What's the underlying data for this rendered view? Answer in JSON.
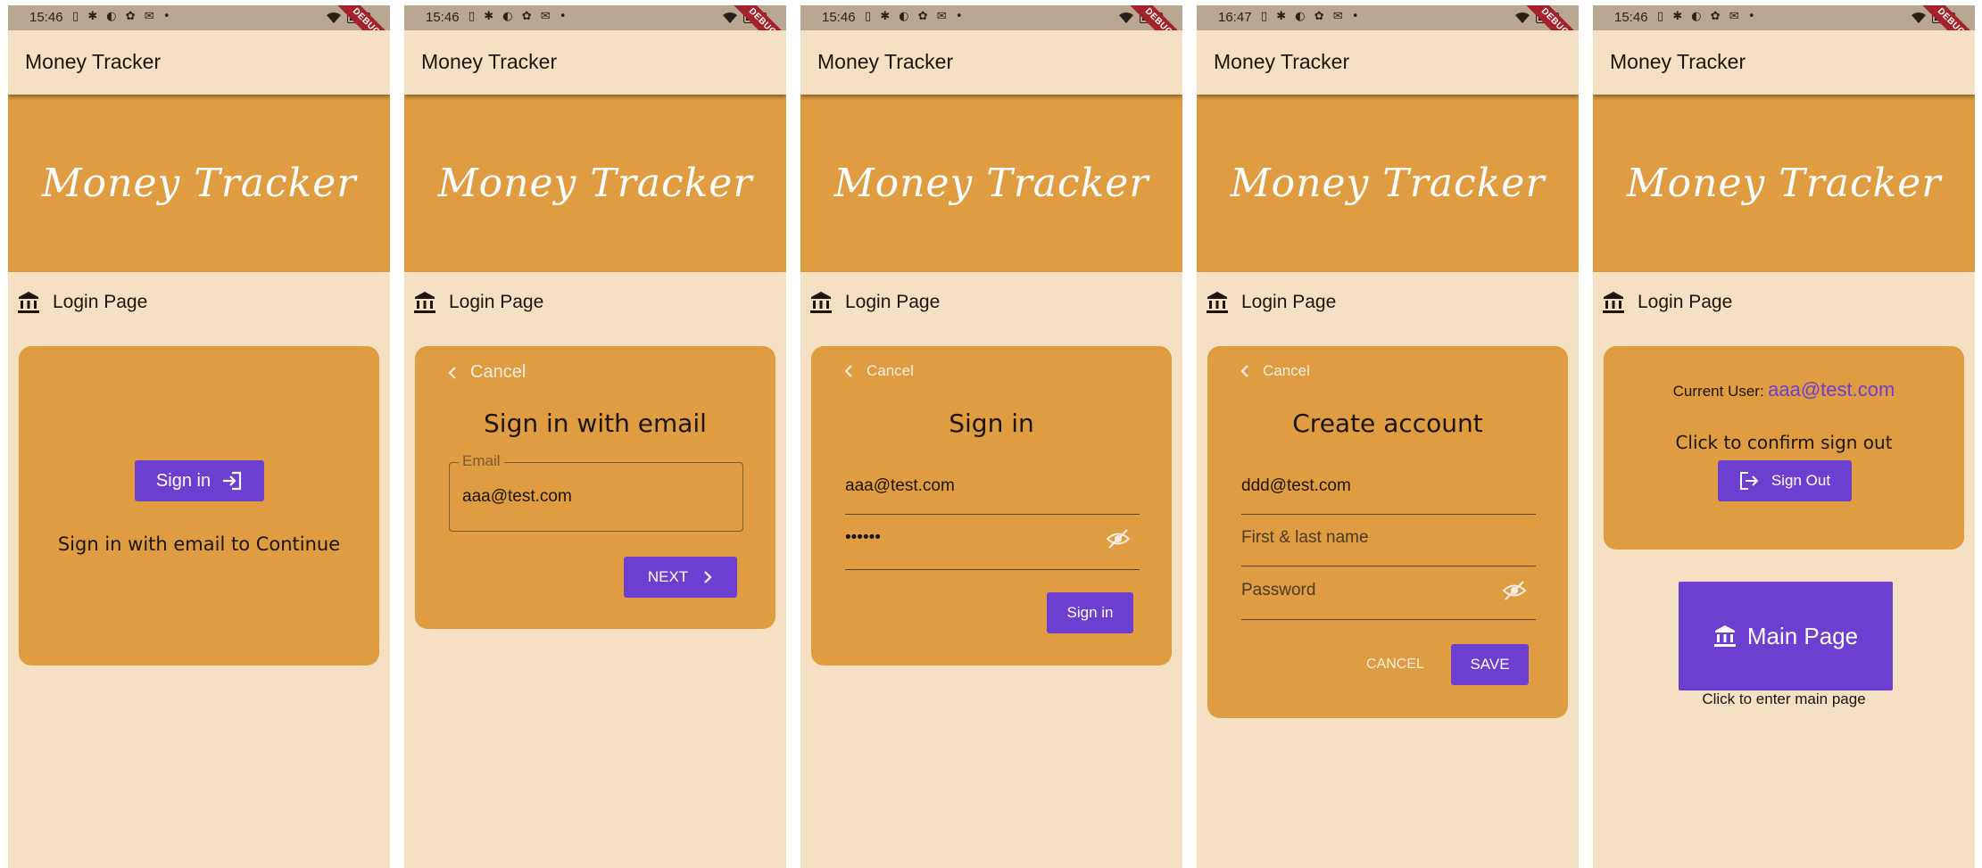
{
  "status_times": [
    "15:46",
    "15:46",
    "15:46",
    "16:47",
    "15:46"
  ],
  "status_icons": "▯ ✱ ◐ ✿ ✉ •",
  "debug_label": "DEBUG",
  "app_title": "Money Tracker",
  "hero_title": "Money Tracker",
  "page_label": "Login Page",
  "screen1": {
    "sign_in_button": "Sign in",
    "subtitle": "Sign in with email to Continue"
  },
  "screen2": {
    "cancel": "Cancel",
    "heading": "Sign in with email",
    "email_label": "Email",
    "email_value": "aaa@test.com",
    "next_button": "NEXT"
  },
  "screen3": {
    "cancel": "Cancel",
    "heading": "Sign in",
    "email_value": "aaa@test.com",
    "password_value": "••••••",
    "sign_in_button": "Sign in"
  },
  "screen4": {
    "cancel": "Cancel",
    "heading": "Create account",
    "email_value": "ddd@test.com",
    "name_placeholder": "First & last name",
    "password_placeholder": "Password",
    "cancel_button": "CANCEL",
    "save_button": "SAVE"
  },
  "screen5": {
    "current_user_label": "Current User:",
    "current_user_email": "aaa@test.com",
    "confirm_text": "Click to confirm sign out",
    "sign_out_button": "Sign Out",
    "main_page_button": "Main Page",
    "main_page_caption": "Click to enter main page"
  },
  "colors": {
    "background": "#f6e0c3",
    "accent_orange": "#e09c41",
    "button_purple": "#6d3fd0",
    "status_bar": "#b9a791"
  }
}
